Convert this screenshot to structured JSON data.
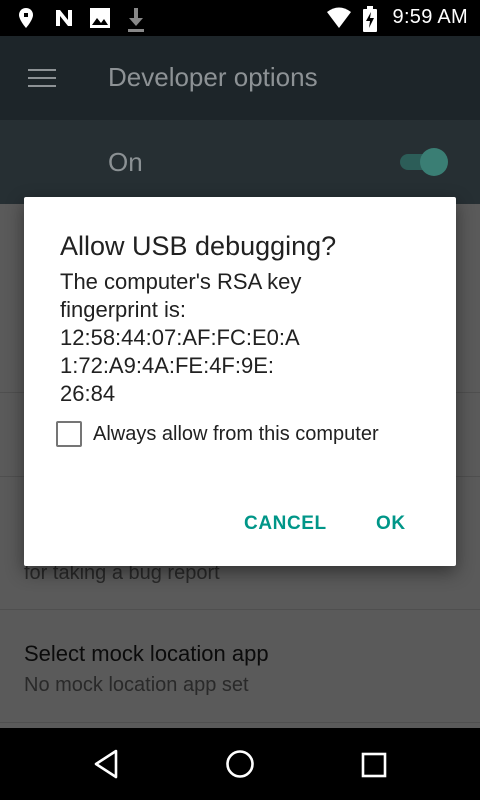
{
  "status_bar": {
    "time": "9:59 AM",
    "icons": [
      "location-pin-icon",
      "n-notification-icon",
      "image-icon",
      "download-icon",
      "wifi-icon",
      "battery-charging-icon"
    ]
  },
  "toolbar": {
    "title": "Developer options",
    "menu_icon": "hamburger-menu-icon"
  },
  "master_switch": {
    "label": "On",
    "state": "on"
  },
  "background_list": {
    "partial_summary": "for taking a bug report",
    "items": [
      {
        "title": "Select mock location app",
        "summary": "No mock location app set"
      }
    ]
  },
  "dialog": {
    "title": "Allow USB debugging?",
    "message": "The computer's RSA key\nfingerprint is:\n12:58:44:07:AF:FC:E0:A\n1:72:A9:4A:FE:4F:9E:\n26:84",
    "checkbox_label": "Always allow from this computer",
    "checkbox_checked": false,
    "cancel_label": "CANCEL",
    "ok_label": "OK",
    "accent_color": "#009688"
  },
  "nav_bar": {
    "buttons": [
      "back-icon",
      "home-icon",
      "recents-icon"
    ]
  }
}
